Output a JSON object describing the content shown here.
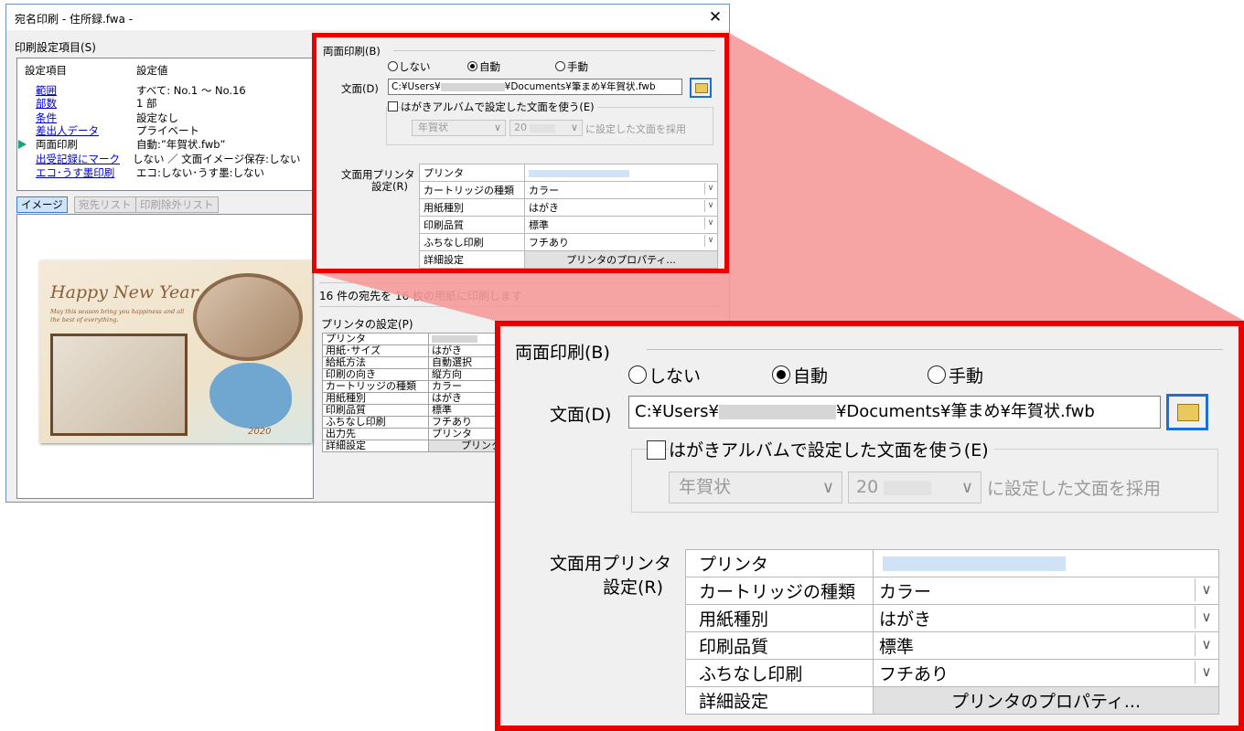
{
  "window": {
    "title": "宛名印刷 - 住所録.fwa -",
    "close_glyph": "✕",
    "settings_group_label": "印刷設定項目(S)",
    "list_header": [
      "設定項目",
      "設定値"
    ],
    "settings_rows": [
      {
        "name": "範囲",
        "value": "すべて: No.1 〜 No.16"
      },
      {
        "name": "部数",
        "value": "1 部"
      },
      {
        "name": "条件",
        "value": "設定なし"
      },
      {
        "name": "差出人データ",
        "value": "プライベート"
      },
      {
        "name": "両面印刷",
        "value": "自動:”年賀状.fwb”"
      },
      {
        "name": "出受記録にマーク",
        "value": "しない ／ 文面イメージ保存:しない"
      },
      {
        "name": "エコ･うす墨印刷",
        "value": "エコ:しない･うす墨:しない"
      }
    ],
    "view_tabs": [
      "イメージ",
      "宛先リスト",
      "印刷除外リスト"
    ],
    "card": {
      "headline": "Happy New Year",
      "subline": "May this season bring you happiness and all the best of everything.",
      "year": "2020"
    },
    "summary": "16 件の宛先を 16 枚の用紙に印刷します",
    "printer_group_label": "プリンタの設定(P)",
    "printer_rows": [
      {
        "label": "プリンタ",
        "value": ""
      },
      {
        "label": "用紙･サイズ",
        "value": "はがき"
      },
      {
        "label": "給紙方法",
        "value": "自動選択"
      },
      {
        "label": "印刷の向き",
        "value": "縦方向"
      },
      {
        "label": "カートリッジの種類",
        "value": "カラー"
      },
      {
        "label": "用紙種別",
        "value": "はがき"
      },
      {
        "label": "印刷品質",
        "value": "標準"
      },
      {
        "label": "ふちなし印刷",
        "value": "フチあり"
      },
      {
        "label": "出力先",
        "value": "プリンタ"
      },
      {
        "label": "詳細設定",
        "value": "プリンタ"
      }
    ]
  },
  "duplex": {
    "group_label": "両面印刷(B)",
    "options": [
      "しない",
      "自動",
      "手動"
    ],
    "selected_option": "自動",
    "file_label": "文面(D)",
    "file_path_prefix": "C:¥Users¥",
    "file_path_suffix": "¥Documents¥筆まめ¥年賀状.fwb",
    "album_checkbox_label": "はがきアルバムで設定した文面を使う(E)",
    "album_checked": false,
    "album_type": "年賀状",
    "album_year": "20",
    "album_suffix": "に設定した文面を採用",
    "printer_group_label": "文面用プリンタ",
    "printer_group_label2": "設定(R)",
    "printer_rows": [
      {
        "label": "プリンタ",
        "value": "",
        "dropdown": false
      },
      {
        "label": "カートリッジの種類",
        "value": "カラー",
        "dropdown": true
      },
      {
        "label": "用紙種別",
        "value": "はがき",
        "dropdown": true
      },
      {
        "label": "印刷品質",
        "value": "標準",
        "dropdown": true
      },
      {
        "label": "ふちなし印刷",
        "value": "フチあり",
        "dropdown": true
      }
    ],
    "detail_label": "詳細設定",
    "properties_button": "プリンタのプロパティ...",
    "chevron_glyph": "∨"
  },
  "colors": {
    "highlight_red": "#e60000",
    "callout_fill": "#f59a9a",
    "link_blue": "#0000cc",
    "focus_blue": "#1c6ed8"
  }
}
